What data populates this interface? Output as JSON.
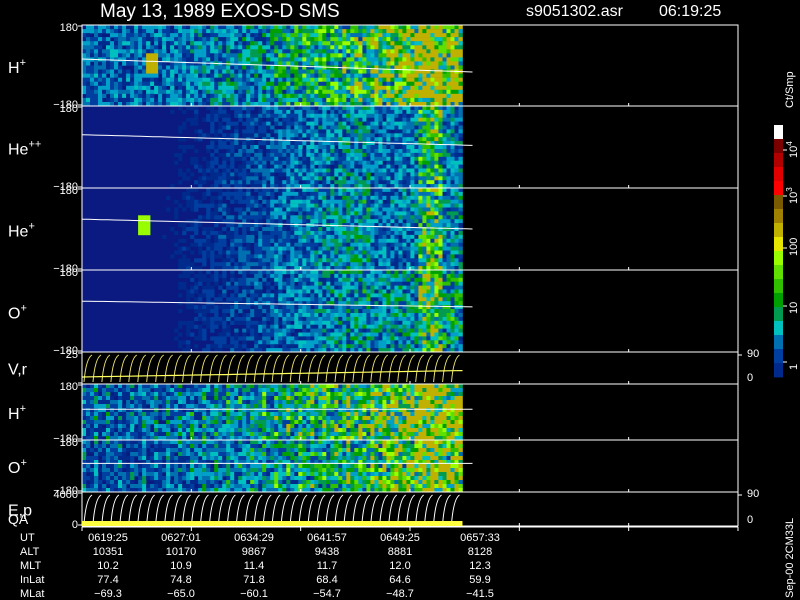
{
  "header": {
    "title": "May 13, 1989   EXOS-D SMS",
    "file": "s9051302.asr",
    "time": "06:19:25"
  },
  "colorbar": {
    "title": "Ct/Smp",
    "labels": [
      "10^4",
      "10^3",
      "100",
      "10",
      "1"
    ],
    "colors": [
      "#ffffff",
      "#7a0000",
      "#b00000",
      "#e00000",
      "#ff0000",
      "#7a5a00",
      "#a08000",
      "#c0b000",
      "#e6e600",
      "#99ff00",
      "#60e000",
      "#30c000",
      "#00a000",
      "#009a50",
      "#00c0c0",
      "#0070b0",
      "#003fa0",
      "#002a8c"
    ]
  },
  "chart_data": {
    "type": "heatmap",
    "panels": [
      {
        "id": "h-plus",
        "label": "H",
        "sup": "+",
        "ytop": "180",
        "ybot": "−180",
        "kind": "spec",
        "cutoff": 0.58,
        "sweep": [
          0.42,
          0.58
        ],
        "base": 0.34,
        "boost": [
          0.35,
          0.6,
          0.82,
          1.0
        ],
        "spot": [
          0.18,
          0.45,
          0.95
        ]
      },
      {
        "id": "he-plus-plus",
        "label": "He",
        "sup": "++",
        "ytop": "180",
        "ybot": "−180",
        "kind": "spec",
        "cutoff": 0.58,
        "sweep": [
          0.35,
          0.48
        ],
        "base": 0.04,
        "boost": [
          0.62,
          0.8,
          0.85,
          0.55
        ]
      },
      {
        "id": "he-plus",
        "label": "He",
        "sup": "+",
        "ytop": "180",
        "ybot": "−180",
        "kind": "spec",
        "cutoff": 0.58,
        "sweep": [
          0.38,
          0.5
        ],
        "base": 0.05,
        "boost": [
          0.66,
          0.82,
          0.9,
          0.58
        ],
        "spot": [
          0.16,
          0.45,
          0.9
        ]
      },
      {
        "id": "o-plus",
        "label": "O",
        "sup": "+",
        "ytop": "180",
        "ybot": "−180",
        "kind": "spec",
        "cutoff": 0.58,
        "sweep": [
          0.38,
          0.45
        ],
        "base": 0.05,
        "boost": [
          0.54,
          0.78,
          0.9,
          0.72
        ]
      },
      {
        "id": "v-r",
        "label": "V,r",
        "sup": "",
        "ytop": "25",
        "ybot": "",
        "kind": "line",
        "right_top": "90",
        "right_bot": "0"
      },
      {
        "id": "h-plus-2",
        "label": "H",
        "sup": "+",
        "ytop": "180",
        "ybot": "−180",
        "kind": "spec",
        "cutoff": 0.58,
        "sweep": [
          0.45,
          0.45
        ],
        "base": 0.3,
        "boost": [
          0.4,
          0.6,
          0.82,
          1.0
        ],
        "stripes": true
      },
      {
        "id": "o-plus-2",
        "label": "O",
        "sup": "+",
        "ytop": "180",
        "ybot": "−180",
        "kind": "spec",
        "cutoff": 0.58,
        "sweep": [
          0.45,
          0.45
        ],
        "base": 0.24,
        "boost": [
          0.4,
          0.62,
          0.82,
          1.0
        ],
        "stripes": true
      },
      {
        "id": "e-p",
        "label": "E,p",
        "sup": "",
        "ytop": "4000",
        "ybot": "0",
        "kind": "line",
        "right_top": "90",
        "right_bot": "0"
      }
    ],
    "qa_label": "QA",
    "qa_fraction": 0.58,
    "x_ticks": [
      "0619:25",
      "0627:01",
      "0634:29",
      "0641:57",
      "0649:25",
      "0657:33"
    ],
    "ephemeris": [
      {
        "name": "UT",
        "values": [
          "0619:25",
          "0627:01",
          "0634:29",
          "0641:57",
          "0649:25",
          "0657:33"
        ]
      },
      {
        "name": "ALT",
        "values": [
          "10351",
          "10170",
          "9867",
          "9438",
          "8881",
          "8128"
        ]
      },
      {
        "name": "MLT",
        "values": [
          "10.2",
          "10.9",
          "11.4",
          "11.7",
          "12.0",
          "12.3"
        ]
      },
      {
        "name": "InLat",
        "values": [
          "77.4",
          "74.8",
          "71.8",
          "68.4",
          "64.6",
          "59.9"
        ]
      },
      {
        "name": "MLat",
        "values": [
          "−69.3",
          "−65.0",
          "−60.1",
          "−54.7",
          "−48.7",
          "−41.5"
        ]
      }
    ],
    "footer_note": "Sep-00 2CM33L"
  }
}
